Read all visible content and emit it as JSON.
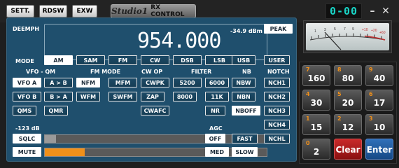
{
  "titlebar": {
    "buttons": [
      "SETT.",
      "RDSW",
      "EXW"
    ],
    "brand_name": "Studio1",
    "brand_sub": "RX CONTROL",
    "clock": "0-00",
    "minimize": "–",
    "close": "✕"
  },
  "display": {
    "deemph_label": "DEEMPH",
    "frequency": "954.000",
    "dbm": "-34.9 dBm",
    "peak_label": "PEAK"
  },
  "mode": {
    "label": "MODE",
    "buttons": [
      "AM",
      "SAM",
      "FM",
      "CW",
      "DSB",
      "LSB",
      "USB",
      "USER"
    ],
    "active": "AM"
  },
  "section_labels": {
    "vfo_qm": "VFO - QM",
    "fm_mode": "FM MODE",
    "cw_op": "CW OP",
    "filter": "FILTER",
    "nb": "NB",
    "notch": "NOTCH",
    "agc": "AGC"
  },
  "vfo": {
    "vfo_a": "VFO A",
    "a_to_b": "A > B",
    "vfo_b": "VFO B",
    "b_to_a": "B > A",
    "qms": "QMS",
    "qmr": "QMR"
  },
  "fm_mode": {
    "nfm": "NFM",
    "mfm": "MFM",
    "wfm": "WFM",
    "swfm": "SWFM"
  },
  "cw_op": {
    "cwpk": "CWPK",
    "zap": "ZAP",
    "cwafc": "CWAFC"
  },
  "filter": {
    "f5200": "5200",
    "f6000": "6000",
    "f8000": "8000",
    "f11k": "11K",
    "nr": "NR"
  },
  "nb": {
    "nbw": "NBW",
    "nbn": "NBN",
    "nboff": "NBOFF"
  },
  "notch": [
    "NCH1",
    "NCH2",
    "NCH3",
    "NCH4",
    "NCHL"
  ],
  "agc": {
    "off": "OFF",
    "fast": "FAST",
    "med": "MED",
    "slow": "SLOW"
  },
  "level": {
    "label": "-123 dB",
    "sqlc": "SQLC",
    "mute": "MUTE",
    "squelch_fraction": 0.05,
    "volume_fraction": 0.18
  },
  "meter": {
    "scale": [
      "1",
      "3",
      "5",
      "7",
      "9",
      "+10",
      "+20",
      "+60"
    ]
  },
  "keypad": {
    "keys": [
      {
        "digit": "7",
        "value": "160"
      },
      {
        "digit": "8",
        "value": "80"
      },
      {
        "digit": "9",
        "value": "40"
      },
      {
        "digit": "4",
        "value": "30"
      },
      {
        "digit": "5",
        "value": "20"
      },
      {
        "digit": "6",
        "value": "17"
      },
      {
        "digit": "1",
        "value": "15"
      },
      {
        "digit": "2",
        "value": "12"
      },
      {
        "digit": "3",
        "value": "10"
      },
      {
        "digit": "0",
        "value": "2"
      }
    ],
    "clear": "Clear",
    "enter": "Enter"
  },
  "colors": {
    "panel": "#1f4f6d",
    "orange": "#f0901a",
    "clock": "#19d3c5"
  }
}
